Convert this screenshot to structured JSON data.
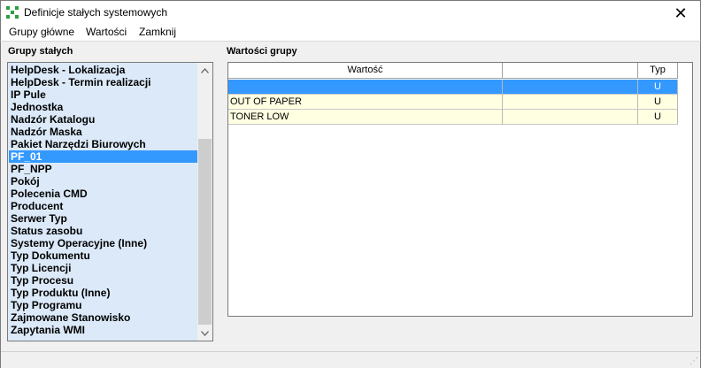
{
  "window": {
    "title": "Definicje stałych systemowych"
  },
  "menu": [
    "Grupy główne",
    "Wartości",
    "Zamknij"
  ],
  "groups": {
    "label": "Grupy stałych",
    "items": [
      "HelpDesk - Lokalizacja",
      "HelpDesk - Termin realizacji",
      "IP Pule",
      "Jednostka",
      "Nadzór Katalogu",
      "Nadzór Maska",
      "Pakiet Narzędzi Biurowych",
      "PF_01",
      "PF_NPP",
      "Pokój",
      "Polecenia CMD",
      "Producent",
      "Serwer Typ",
      "Status zasobu",
      "Systemy Operacyjne (Inne)",
      "Typ Dokumentu",
      "Typ Licencji",
      "Typ Procesu",
      "Typ Produktu (Inne)",
      "Typ Programu",
      "Zajmowane Stanowisko",
      "Zapytania WMI"
    ],
    "selected_index": 7
  },
  "values": {
    "label": "Wartości grupy",
    "columns": [
      "Wartość",
      "",
      "Typ"
    ],
    "rows": [
      {
        "value": "",
        "extra": "",
        "type": "U"
      },
      {
        "value": "OUT OF PAPER",
        "extra": "",
        "type": "U"
      },
      {
        "value": "TONER LOW",
        "extra": "",
        "type": "U"
      }
    ],
    "selected_row": 0
  },
  "colors": {
    "selection": "#3399ff",
    "list_bg": "#dbe9f9",
    "cell_bg": "#ffffe1"
  }
}
